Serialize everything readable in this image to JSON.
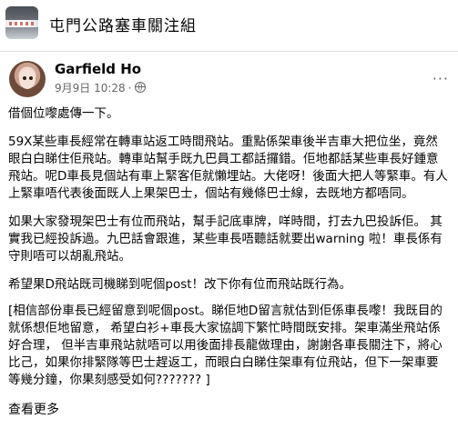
{
  "group": {
    "title": "屯門公路塞車關注組"
  },
  "post": {
    "author": "Garfield Ho",
    "date": "9月9日 10:28",
    "separator": "·",
    "more_label": "···",
    "paragraphs": [
      "借個位嚟處傳一下。",
      "59X某些車長經常在轉車站返工時間飛站。重點係架車後半吉車大把位坐，竟然眼白白睇住佢飛站。轉車站幫手既九巴員工都話攞錯。佢地都話某些車長好鍾意飛站。呢D車長見個站有車上緊客佢就懶埋站。大佬呀！後面大把人等緊車。有人上緊車唔代表後面既人上果架巴士，個站有幾條巴士線，去既地方都唔同。",
      "如果大家發現架巴士有位而飛站，幫手記底車牌，咩時間，打去九巴投訴佢。 其實我已經投訴過。九巴話會跟進，某些車長唔聽話就要出warning 啦！車長係有守則唔可以胡亂飛站。",
      "希望果D飛站既司機睇到呢個post！改下你有位而飛站既行為。",
      "[相信部份車長已經留意到呢個post。睇佢地D留言就估到佢係車長嚟！我既目的就係想佢地留意， 希望白衫+車長大家協調下繁忙時間既安排。架車滿坐飛站係好合理， 但半吉車飛站就唔可以用後面排長龍做理由，謝謝各車長關注下，將心比己，如果你排緊隊等巴士趕返工，而眼白白睇住架車有位飛站，但下一架車要等幾分鐘，你果刻感受如何??????? ]"
    ],
    "see_more": "查看更多"
  }
}
